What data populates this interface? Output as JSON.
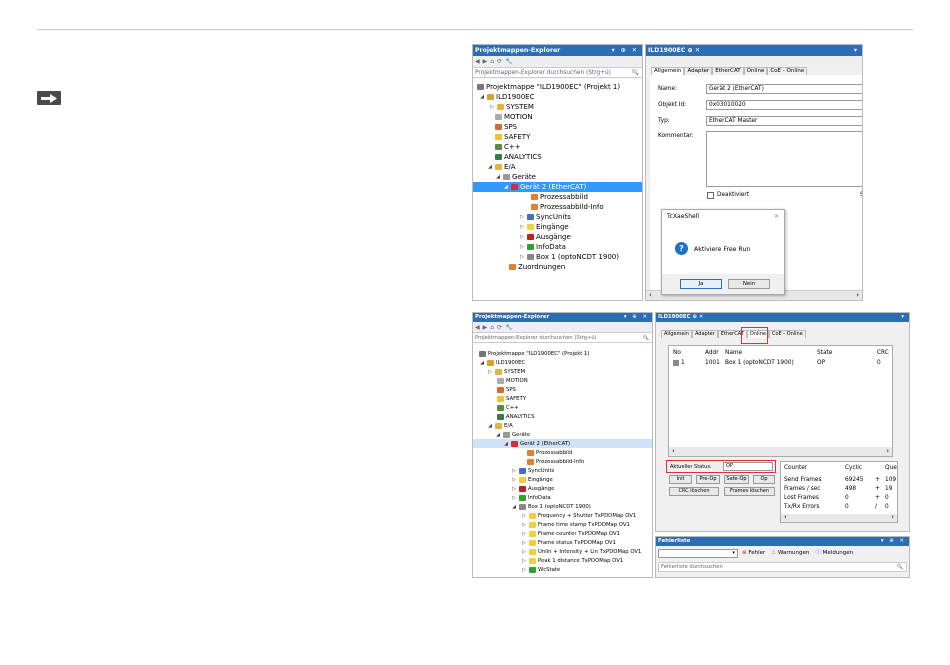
{
  "top": {
    "explorer": {
      "title": "Projektmappen-Explorer",
      "controls": "▾ ⊕ ✕",
      "search": "Projektmappen-Explorer durchsuchen (Strg+ü)",
      "tree": [
        {
          "label": "Projektmappe \"ILD1900EC\" (Projekt 1)"
        },
        {
          "label": "ILD1900EC"
        },
        {
          "label": "SYSTEM"
        },
        {
          "label": "MOTION"
        },
        {
          "label": "SPS"
        },
        {
          "label": "SAFETY"
        },
        {
          "label": "C++"
        },
        {
          "label": "ANALYTICS"
        },
        {
          "label": "E/A"
        },
        {
          "label": "Geräte"
        },
        {
          "label": "Gerät 2 (EtherCAT)"
        },
        {
          "label": "Prozessabbild"
        },
        {
          "label": "Prozessabbild-Info"
        },
        {
          "label": "SyncUnits"
        },
        {
          "label": "Eingänge"
        },
        {
          "label": "Ausgänge"
        },
        {
          "label": "InfoData"
        },
        {
          "label": "Box 1 (optoNCDT 1900)"
        },
        {
          "label": "Zuordnungen"
        }
      ]
    },
    "doc": {
      "tab": "ILD1900EC",
      "tabs": [
        "Allgemein",
        "Adapter",
        "EtherCAT",
        "Online",
        "CoE - Online"
      ],
      "name_label": "Name:",
      "name_value": "Gerät 2 (EtherCAT)",
      "id_label": "Objekt Id:",
      "id_value": "0x03010020",
      "type_label": "Typ:",
      "type_value": "EtherCAT Master",
      "comment_label": "Kommentar:",
      "disabled_label": "Deaktiviert",
      "side_letter": "S",
      "dialog": {
        "title": "TcXaeShell",
        "message": "Aktiviere Free Run",
        "yes": "Ja",
        "no": "Nein"
      }
    }
  },
  "bottom": {
    "explorer": {
      "title": "Projektmappen-Explorer",
      "controls": "▾ ⊕ ✕",
      "search": "Projektmappen-Explorer durchsuchen (Strg+ü)",
      "tree": [
        {
          "label": "Projektmappe \"ILD1900EC\" (Projekt 1)"
        },
        {
          "label": "ILD1900EC"
        },
        {
          "label": "SYSTEM"
        },
        {
          "label": "MOTION"
        },
        {
          "label": "SPS"
        },
        {
          "label": "SAFETY"
        },
        {
          "label": "C++"
        },
        {
          "label": "ANALYTICS"
        },
        {
          "label": "E/A"
        },
        {
          "label": "Geräte"
        },
        {
          "label": "Gerät 2 (EtherCAT)"
        },
        {
          "label": "Prozessabbild"
        },
        {
          "label": "Prozessabbild-Info"
        },
        {
          "label": "SyncUnits"
        },
        {
          "label": "Eingänge"
        },
        {
          "label": "Ausgänge"
        },
        {
          "label": "InfoData"
        },
        {
          "label": "Box 1 (optoNCDT 1900)"
        },
        {
          "label": "Frequency + Shutter TxPDOMap OV1"
        },
        {
          "label": "Frame time stamp TxPDOMap OV1"
        },
        {
          "label": "Frame counter TxPDOMap OV1"
        },
        {
          "label": "Frame status TxPDOMap OV1"
        },
        {
          "label": "Unlin + Intensity + Lin TxPDOMap OV1"
        },
        {
          "label": "Peak 1 distance TxPDOMap OV1"
        },
        {
          "label": "WcState"
        }
      ]
    },
    "doc": {
      "tab": "ILD1900EC",
      "tabs": [
        "Allgemein",
        "Adapter",
        "EtherCAT",
        "Online",
        "CoE - Online"
      ],
      "table_headers": [
        "No",
        "Addr",
        "Name",
        "State",
        "CRC"
      ],
      "table_row": [
        "1",
        "1001",
        "Box 1 (optoNCDT 1900)",
        "OP",
        "0"
      ],
      "status_label": "Aktueller Status:",
      "status_value": "OP",
      "buttons": [
        "Init",
        "Pre-Op",
        "Safe-Op",
        "Op"
      ],
      "crc_clear": "CRC löschen",
      "frames_clear": "Frames löschen",
      "counter_headers": [
        "Counter",
        "Cyclic",
        "Que"
      ],
      "counter_rows": [
        [
          "Send Frames",
          "69245",
          "+",
          "109"
        ],
        [
          "Frames / sec",
          "498",
          "+",
          "19"
        ],
        [
          "Lost Frames",
          "0",
          "+",
          "0"
        ],
        [
          "Tx/Rx Errors",
          "0",
          "/",
          "0"
        ]
      ]
    },
    "errors": {
      "title": "Fehlerliste",
      "errors_btn": "Fehler",
      "warnings_btn": "Warnungen",
      "messages_btn": "Meldungen",
      "search": "Fehlerliste durchsuchen"
    }
  }
}
